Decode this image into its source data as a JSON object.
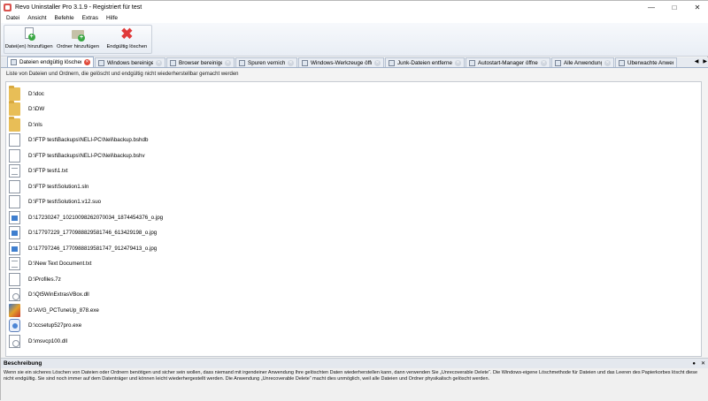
{
  "window": {
    "title": "Revo Uninstaller Pro 3.1.9 - Registriert für test"
  },
  "menu": [
    "Datei",
    "Ansicht",
    "Befehle",
    "Extras",
    "Hilfe"
  ],
  "toolbar": {
    "add_files": "Datei(en) hinzufügen",
    "add_folder": "Ordner hinzufügen",
    "delete_permanently": "Endgültig löschen"
  },
  "tabs": [
    "Dateien endgültig löschen...",
    "Windows bereinigen...",
    "Browser bereinigen...",
    "Spuren vernichten",
    "Windows-Werkzeuge öffnen...",
    "Junk-Dateien entfernen...",
    "Autostart-Manager öffnen...",
    "Alle Anwendungen",
    "Überwachte Anwendu"
  ],
  "list_caption": "Liste von Dateien und Ordnern, die gelöscht und endgültig nicht wiederherstellbar gemacht werden",
  "files": [
    {
      "type": "folder",
      "name": "D:\\doc"
    },
    {
      "type": "folder",
      "name": "D:\\DW"
    },
    {
      "type": "folder",
      "name": "D:\\nls"
    },
    {
      "type": "doc",
      "name": "D:\\FTP test\\Backups\\NELI-PC\\Neli\\backup.bshdb"
    },
    {
      "type": "doc",
      "name": "D:\\FTP test\\Backups\\NELI-PC\\Neli\\backup.bshv"
    },
    {
      "type": "text",
      "name": "D:\\FTP test\\1.txt"
    },
    {
      "type": "doc",
      "name": "D:\\FTP test\\Solution1.sln"
    },
    {
      "type": "doc",
      "name": "D:\\FTP test\\Solution1.v12.suo"
    },
    {
      "type": "img",
      "name": "D:\\17230247_10210098262070034_1874454376_o.jpg"
    },
    {
      "type": "img",
      "name": "D:\\17797229_1770988829581746_613429198_o.jpg"
    },
    {
      "type": "img",
      "name": "D:\\17797246_1770988819581747_912479413_o.jpg"
    },
    {
      "type": "text",
      "name": "D:\\New Text Document.txt"
    },
    {
      "type": "doc",
      "name": "D:\\Profiles.7z"
    },
    {
      "type": "dll",
      "name": "D:\\Qt5WinExtrasVBox.dll"
    },
    {
      "type": "avg",
      "name": "D:\\AVG_PCTuneUp_878.exe"
    },
    {
      "type": "setup",
      "name": "D:\\ccsetup527pro.exe"
    },
    {
      "type": "dll",
      "name": "D:\\msvcp100.dll"
    }
  ],
  "description": {
    "title": "Beschreibung",
    "text": "Wenn sie ein sicheres Löschen von Dateien oder Ordnern benötigen und sicher sein wollen, dass niemand mit irgendeiner Anwendung Ihre gelöschten Daten wiederherstellen kann, dann verwenden Sie „Unrecoverable Delete“. Die Windows-eigene Löschmethode für Dateien und das Leeren des Papierkorbes löscht diese nicht endgültig. Sie sind noch immer auf dem Datenträger und können leicht wiederhergestellt werden. Die Anwendung „Unrecoverable Delete“ macht dies unmöglich, weil alle Dateien und Ordner physikalisch gelöscht werden."
  }
}
